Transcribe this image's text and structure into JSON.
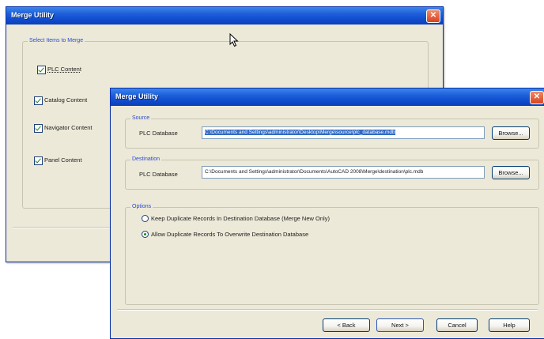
{
  "back_window": {
    "title": "Merge Utility",
    "close_glyph": "✕",
    "group_title": "Select Items to Merge",
    "items": [
      {
        "label": "PLC Content"
      },
      {
        "label": "Catalog Content"
      },
      {
        "label": "Navigator Content"
      },
      {
        "label": "Panel Content"
      }
    ]
  },
  "front_window": {
    "title": "Merge Utility",
    "close_glyph": "✕",
    "source": {
      "group_title": "Source",
      "field_label": "PLC Database",
      "path": "C:\\Documents and Settings\\administrator\\Desktop\\Merge\\source\\plc_database.mdb",
      "browse_label": "Browse..."
    },
    "destination": {
      "group_title": "Destination",
      "field_label": "PLC Database",
      "path": "C:\\Documents and Settings\\administrator\\Documents\\AutoCAD 2008\\Merge\\destination\\plc.mdb",
      "browse_label": "Browse..."
    },
    "options": {
      "group_title": "Options",
      "radios": [
        {
          "label": "Keep Duplicate Records In Destination Database (Merge New Only)",
          "selected": false
        },
        {
          "label": "Allow Duplicate Records To Overwrite Destination Database",
          "selected": true
        }
      ]
    },
    "buttons": {
      "back": "< Back",
      "next": "Next >",
      "cancel": "Cancel",
      "help": "Help"
    }
  },
  "colors": {
    "titlebar": "#0f4ccf",
    "window_bg": "#ece9d8",
    "selection": "#316ac5"
  },
  "icons": {
    "cursor": "mouse-pointer-icon",
    "close": "close-icon"
  }
}
